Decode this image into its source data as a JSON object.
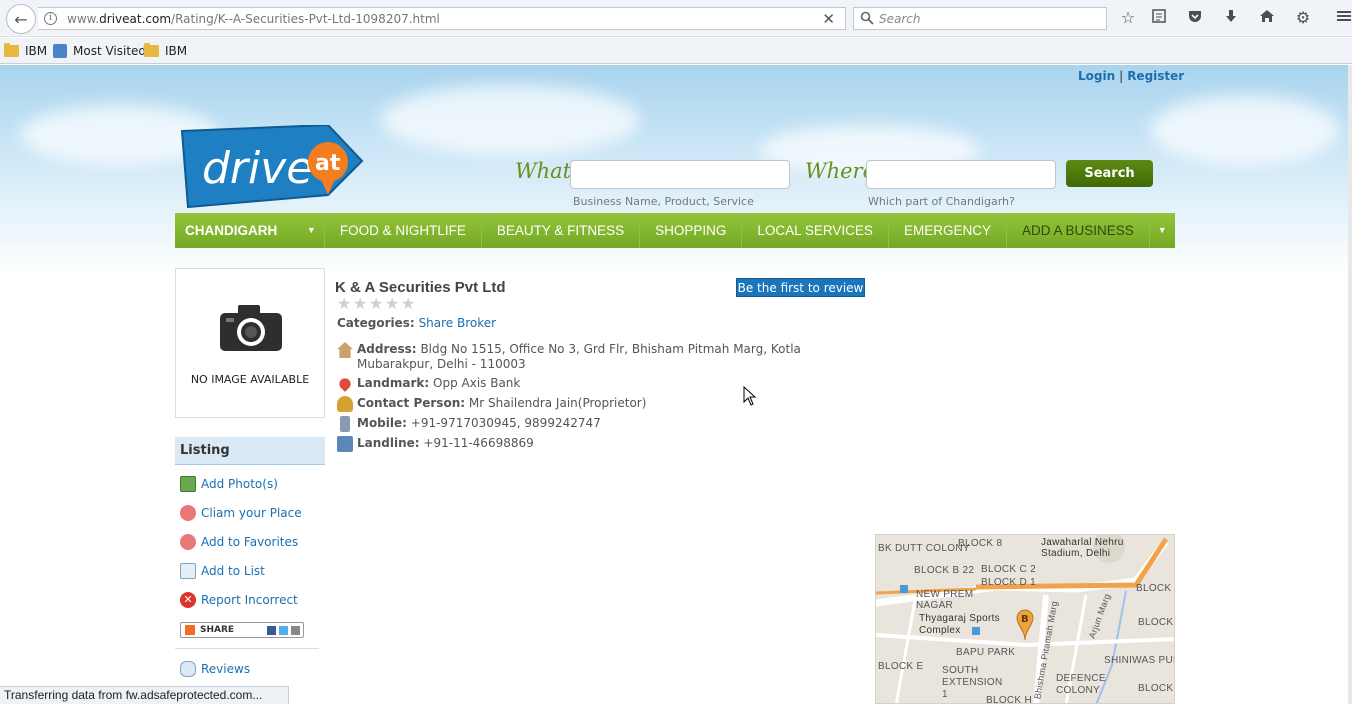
{
  "browser": {
    "url_prefix": "www.",
    "url_domain": "driveat.com",
    "url_path": "/Rating/K--A-Securities-Pvt-Ltd-1098207.html",
    "search_placeholder": "Search",
    "bookmarks": [
      "IBM",
      "Most Visited",
      "IBM"
    ],
    "status_text": "Transferring data from fw.adsafeprotected.com..."
  },
  "header": {
    "login": "Login",
    "separator": "|",
    "register": "Register",
    "logo_text": "drive",
    "logo_badge": "at",
    "what_label": "What",
    "where_label": "Where",
    "what_hint": "Business Name, Product, Service",
    "where_hint": "Which part of Chandigarh?",
    "search_button": "Search"
  },
  "menu": {
    "city": "CHANDIGARH",
    "items": [
      "FOOD & NIGHTLIFE",
      "BEAUTY & FITNESS",
      "SHOPPING",
      "LOCAL SERVICES",
      "EMERGENCY"
    ],
    "add_business": "ADD A BUSINESS"
  },
  "sidebar": {
    "no_image": "NO IMAGE AVAILABLE",
    "listing_title": "Listing",
    "links": [
      "Add Photo(s)",
      "Cliam your Place",
      "Add to Favorites",
      "Add to List",
      "Report Incorrect"
    ],
    "share_label": "SHARE",
    "reviews": "Reviews"
  },
  "business": {
    "name": "K & A Securities Pvt Ltd",
    "rating": 0,
    "review_button": "Be the first to review",
    "categories_label": "Categories:",
    "category": "Share Broker",
    "address_label": "Address:",
    "address": "Bldg No 1515, Office No 3, Grd Flr, Bhisham Pitmah Marg, Kotla Mubarakpur, Delhi - 110003",
    "landmark_label": "Landmark:",
    "landmark": "Opp Axis Bank",
    "contact_label": "Contact Person:",
    "contact": "Mr Shailendra Jain(Proprietor)",
    "mobile_label": "Mobile:",
    "mobile": "+91-9717030945, 9899242747",
    "landline_label": "Landline:",
    "landline": "+91-11-46698869"
  },
  "map": {
    "labels": [
      "BK DUTT COLONY",
      "BLOCK 8",
      "Jawaharlal Nehru Stadium, Delhi",
      "BLOCK B 22",
      "BLOCK C 2",
      "BLOCK D 1",
      "BLOCK",
      "NEW PREM NAGAR",
      "Thyagaraj Sports Complex",
      "BAPU PARK",
      "BLOCK E",
      "SOUTH EXTENSION 1",
      "SHINIWAS PUR",
      "DEFENCE COLONY",
      "Arjun Marg",
      "Bhishma Pitamah Marg",
      "BLOCK H"
    ],
    "pin_letter": "B"
  },
  "colors": {
    "menu_green": "#84b82f",
    "link_blue": "#1b6fb0",
    "review_button": "#1b75bb",
    "search_button": "#4f7c0e"
  }
}
